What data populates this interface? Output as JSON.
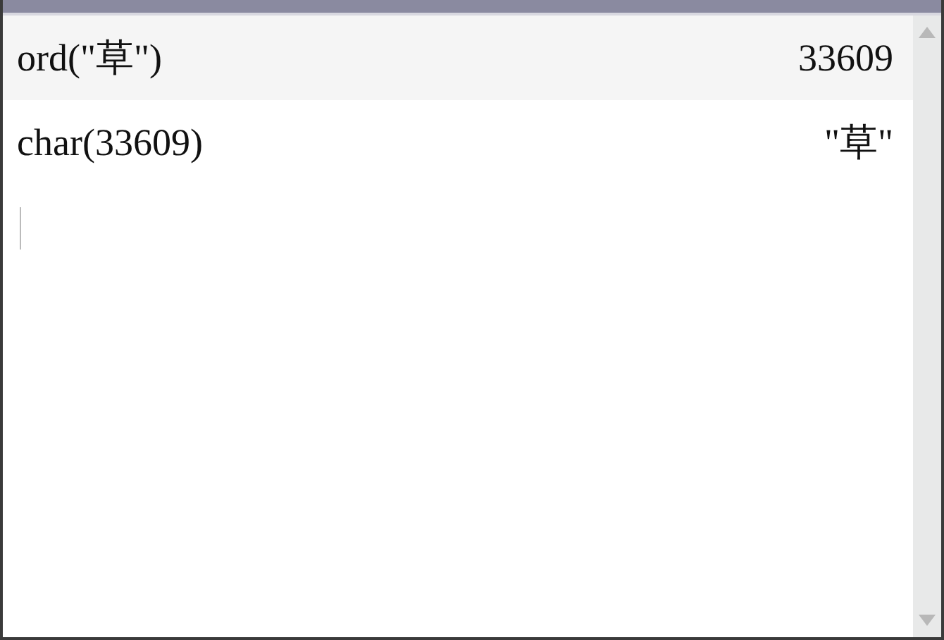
{
  "history": [
    {
      "input": "ord(\"草\")",
      "result": "33609"
    },
    {
      "input": "char(33609)",
      "result": "\"草\""
    }
  ]
}
